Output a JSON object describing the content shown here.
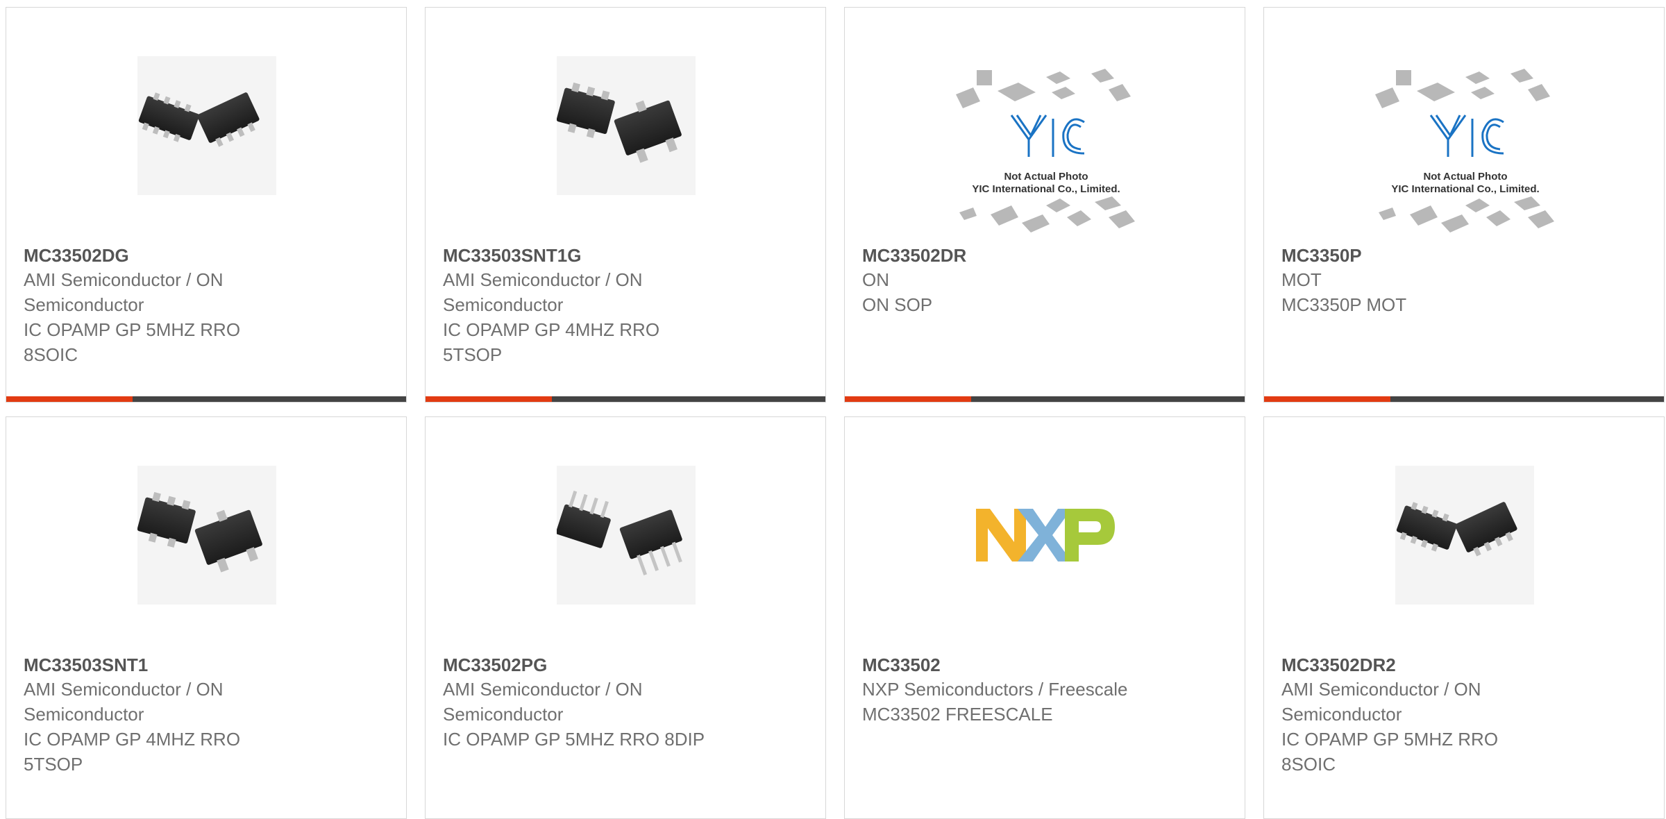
{
  "colors": {
    "accent": "#e23b12",
    "bar": "#444444",
    "part_text": "#555555",
    "body_text": "#6f6f6f"
  },
  "placeholder_caption": {
    "line1": "Not Actual Photo",
    "line2": "YIC International Co., Limited.",
    "logo_text": "YIC"
  },
  "nxp_logo_text": "NXP",
  "products": [
    {
      "part": "MC33502DG",
      "manufacturer": "AMI Semiconductor / ON Semiconductor",
      "description": "IC OPAMP GP 5MHZ RRO 8SOIC",
      "image": "soic-8-chip-icon"
    },
    {
      "part": "MC33503SNT1G",
      "manufacturer": "AMI Semiconductor / ON Semiconductor",
      "description": "IC OPAMP GP 4MHZ RRO 5TSOP",
      "image": "tsop-5-chip-icon"
    },
    {
      "part": "MC33502DR",
      "manufacturer": "ON",
      "description": "ON SOP",
      "image": "yic-placeholder-photo"
    },
    {
      "part": "MC3350P",
      "manufacturer": "MOT",
      "description": "MC3350P MOT",
      "image": "yic-placeholder-photo"
    },
    {
      "part": "MC33503SNT1",
      "manufacturer": "AMI Semiconductor / ON Semiconductor",
      "description": "IC OPAMP GP 4MHZ RRO 5TSOP",
      "image": "tsop-5-chip-icon"
    },
    {
      "part": "MC33502PG",
      "manufacturer": "AMI Semiconductor / ON Semiconductor",
      "description": "IC OPAMP GP 5MHZ RRO 8DIP",
      "image": "dip-8-chip-icon"
    },
    {
      "part": "MC33502",
      "manufacturer": "NXP Semiconductors / Freescale",
      "description": "MC33502 FREESCALE",
      "image": "nxp-logo"
    },
    {
      "part": "MC33502DR2",
      "manufacturer": "AMI Semiconductor / ON Semiconductor",
      "description": "IC OPAMP GP 5MHZ RRO 8SOIC",
      "image": "soic-8-chip-icon"
    }
  ]
}
